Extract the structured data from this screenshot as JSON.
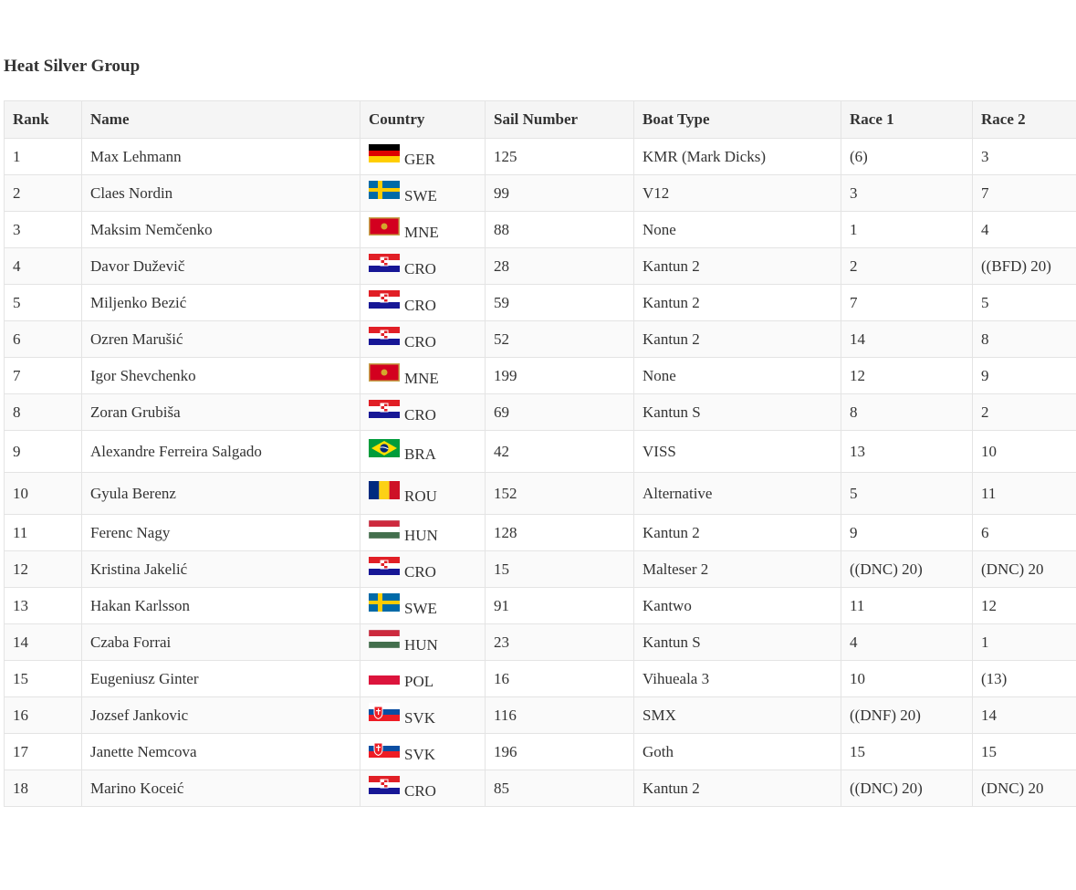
{
  "title": "Heat Silver Group",
  "columns": [
    "Rank",
    "Name",
    "Country",
    "Sail Number",
    "Boat Type",
    "Race 1",
    "Race 2"
  ],
  "rows": [
    {
      "rank": "1",
      "name": "Max Lehmann",
      "flag": "germany-flag-icon",
      "country": "GER",
      "sail": "125",
      "boat": "KMR (Mark Dicks)",
      "race1": "(6)",
      "race2": "3"
    },
    {
      "rank": "2",
      "name": "Claes Nordin",
      "flag": "sweden-flag-icon",
      "country": "SWE",
      "sail": "99",
      "boat": "V12",
      "race1": "3",
      "race2": "7"
    },
    {
      "rank": "3",
      "name": "Maksim Nemčenko",
      "flag": "montenegro-flag-icon",
      "country": "MNE",
      "sail": "88",
      "boat": "None",
      "race1": "1",
      "race2": "4"
    },
    {
      "rank": "4",
      "name": "Davor Duževič",
      "flag": "croatia-flag-icon",
      "country": "CRO",
      "sail": "28",
      "boat": "Kantun 2",
      "race1": "2",
      "race2": "((BFD) 20)"
    },
    {
      "rank": "5",
      "name": "Miljenko Bezić",
      "flag": "croatia-flag-icon",
      "country": "CRO",
      "sail": "59",
      "boat": "Kantun 2",
      "race1": "7",
      "race2": "5"
    },
    {
      "rank": "6",
      "name": "Ozren Marušić",
      "flag": "croatia-flag-icon",
      "country": "CRO",
      "sail": "52",
      "boat": "Kantun 2",
      "race1": "14",
      "race2": "8"
    },
    {
      "rank": "7",
      "name": "Igor Shevchenko",
      "flag": "montenegro-flag-icon",
      "country": "MNE",
      "sail": "199",
      "boat": "None",
      "race1": "12",
      "race2": "9"
    },
    {
      "rank": "8",
      "name": "Zoran Grubiša",
      "flag": "croatia-flag-icon",
      "country": "CRO",
      "sail": "69",
      "boat": "Kantun S",
      "race1": "8",
      "race2": "2"
    },
    {
      "rank": "9",
      "name": "Alexandre Ferreira Salgado",
      "flag": "brazil-flag-icon",
      "country": "BRA",
      "sail": "42",
      "boat": "VISS",
      "race1": "13",
      "race2": "10"
    },
    {
      "rank": "10",
      "name": "Gyula Berenz",
      "flag": "romania-flag-icon",
      "country": "ROU",
      "sail": "152",
      "boat": "Alternative",
      "race1": "5",
      "race2": "11"
    },
    {
      "rank": "11",
      "name": "Ferenc Nagy",
      "flag": "hungary-flag-icon",
      "country": "HUN",
      "sail": "128",
      "boat": "Kantun 2",
      "race1": "9",
      "race2": "6"
    },
    {
      "rank": "12",
      "name": "Kristina Jakelić",
      "flag": "croatia-flag-icon",
      "country": "CRO",
      "sail": "15",
      "boat": "Malteser 2",
      "race1": "((DNC) 20)",
      "race2": "(DNC) 20"
    },
    {
      "rank": "13",
      "name": "Hakan Karlsson",
      "flag": "sweden-flag-icon",
      "country": "SWE",
      "sail": "91",
      "boat": "Kantwo",
      "race1": "11",
      "race2": "12"
    },
    {
      "rank": "14",
      "name": "Czaba Forrai",
      "flag": "hungary-flag-icon",
      "country": "HUN",
      "sail": "23",
      "boat": "Kantun S",
      "race1": "4",
      "race2": "1"
    },
    {
      "rank": "15",
      "name": "Eugeniusz Ginter",
      "flag": "poland-flag-icon",
      "country": "POL",
      "sail": "16",
      "boat": "Vihueala 3",
      "race1": "10",
      "race2": "(13)"
    },
    {
      "rank": "16",
      "name": "Jozsef Jankovic",
      "flag": "slovakia-flag-icon",
      "country": "SVK",
      "sail": "116",
      "boat": "SMX",
      "race1": "((DNF) 20)",
      "race2": "14"
    },
    {
      "rank": "17",
      "name": "Janette Nemcova",
      "flag": "slovakia-flag-icon",
      "country": "SVK",
      "sail": "196",
      "boat": "Goth",
      "race1": "15",
      "race2": "15"
    },
    {
      "rank": "18",
      "name": "Marino Koceić",
      "flag": "croatia-flag-icon",
      "country": "CRO",
      "sail": "85",
      "boat": "Kantun 2",
      "race1": "((DNC) 20)",
      "race2": "(DNC) 20"
    }
  ]
}
